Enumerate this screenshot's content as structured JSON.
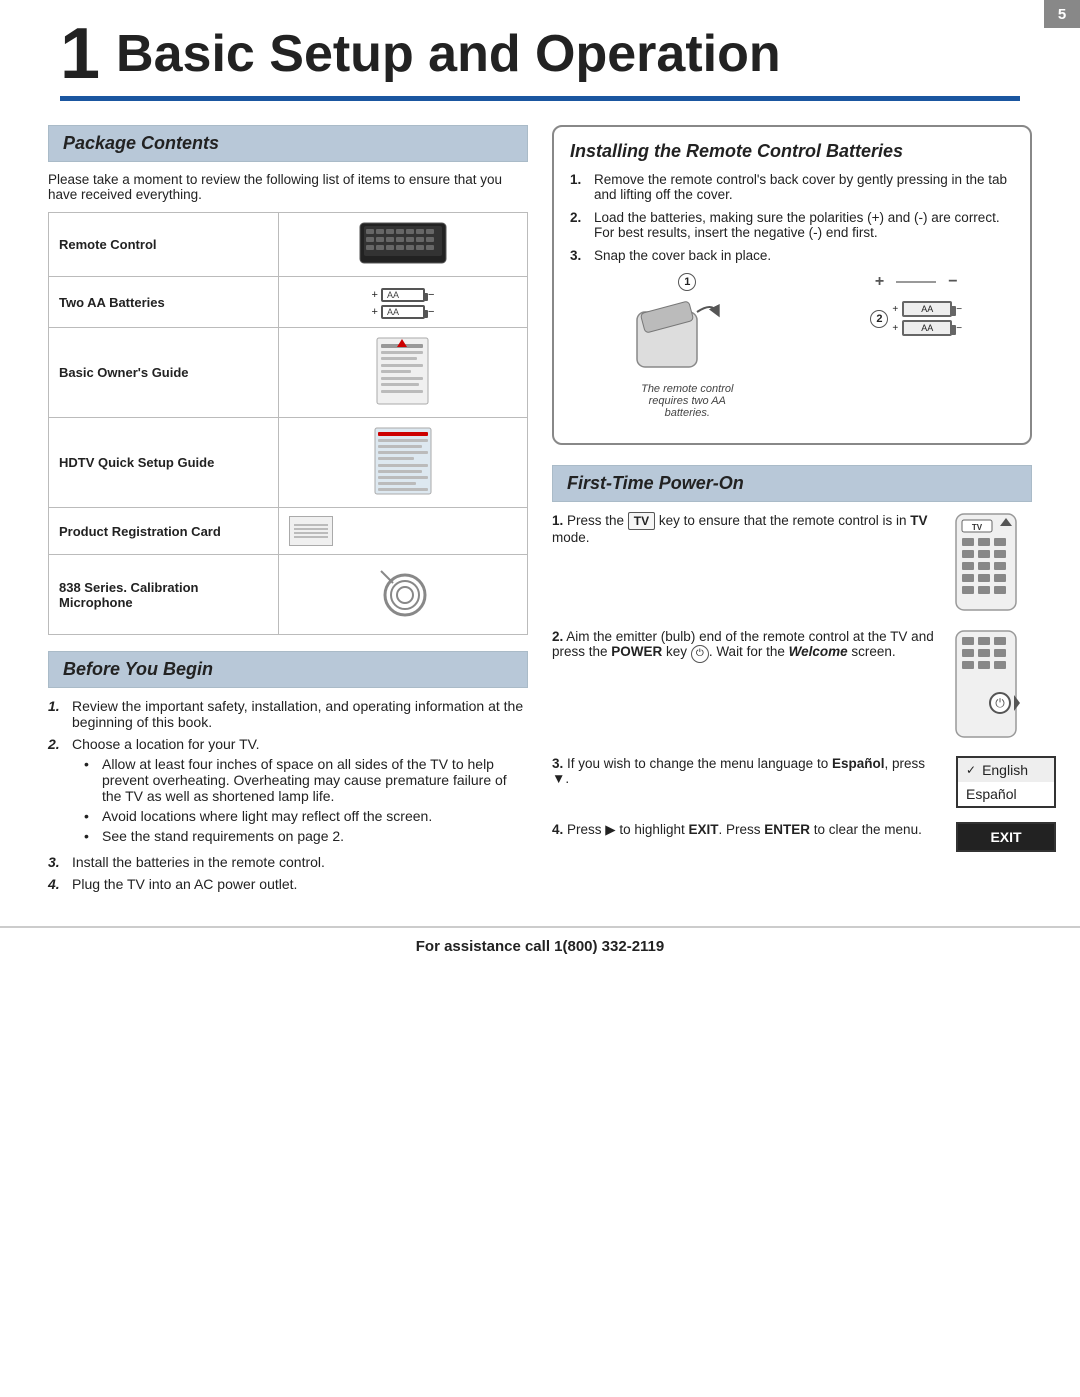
{
  "page": {
    "number": "5",
    "chapter_number": "1",
    "chapter_title": "Basic Setup and Operation"
  },
  "package_contents": {
    "heading": "Package Contents",
    "intro": "Please take a moment to review the following list of items to ensure that you have received everything.",
    "items": [
      {
        "name": "Remote Control",
        "img_type": "remote"
      },
      {
        "name": "Two AA Batteries",
        "img_type": "battery"
      },
      {
        "name": "Basic Owner's Guide",
        "img_type": "owners_guide"
      },
      {
        "name": "HDTV Quick Setup Guide",
        "img_type": "setup_guide"
      },
      {
        "name": "Product Registration Card",
        "img_type": "card"
      },
      {
        "name": "838 Series.  Calibration Microphone",
        "img_type": "microphone"
      }
    ]
  },
  "before_you_begin": {
    "heading": "Before You Begin",
    "steps": [
      {
        "num": "1.",
        "text": "Review the important safety, installation, and operating information at the beginning of this book."
      },
      {
        "num": "2.",
        "text": "Choose a location for your TV.",
        "bullets": [
          "Allow at least four inches of space on all sides of the TV to help prevent overheating.  Overheating may cause premature failure of the TV as well as shortened lamp life.",
          "Avoid locations where light may reflect off the screen.",
          "See the stand requirements on page 2."
        ]
      },
      {
        "num": "3.",
        "text": "Install the batteries in the remote control."
      },
      {
        "num": "4.",
        "text": "Plug the TV into an AC power outlet."
      }
    ]
  },
  "installing_batteries": {
    "heading": "Installing the Remote Control Batteries",
    "steps": [
      {
        "num": "1.",
        "text": "Remove the remote control's back cover by gently pressing in the tab and lifting off the cover."
      },
      {
        "num": "2.",
        "text": "Load the batteries, making sure the polarities (+) and (-) are correct.  For best results, insert the negative (-) end first."
      },
      {
        "num": "3.",
        "text": "Snap the cover back in place."
      }
    ],
    "diagram_note": "The remote control requires two AA batteries.",
    "step1_label": "1",
    "step2_label": "2"
  },
  "first_time_power_on": {
    "heading": "First-Time Power-On",
    "steps": [
      {
        "num": "1.",
        "text_before": "Press the",
        "key": "TV",
        "text_after": "key to ensure that the remote control is in",
        "bold": "TV",
        "text_end": "mode."
      },
      {
        "num": "2.",
        "text": "Aim the emitter (bulb) end of the remote control at the TV and press the",
        "bold1": "POWER",
        "text2": "key",
        "text3": ". Wait for the",
        "bold2": "Welcome",
        "text4": "screen."
      },
      {
        "num": "3.",
        "text": "If you wish to change the menu language to",
        "bold": "Español",
        "text2": ", press ▼."
      },
      {
        "num": "4.",
        "text": "Press ▶ to highlight",
        "bold": "EXIT",
        "text2": ". Press",
        "bold2": "ENTER",
        "text3": "to clear the menu."
      }
    ],
    "lang_menu": {
      "english": "English",
      "espanol": "Español",
      "exit": "EXIT"
    }
  },
  "footer": {
    "text": "For assistance call 1(800) 332-2119"
  }
}
